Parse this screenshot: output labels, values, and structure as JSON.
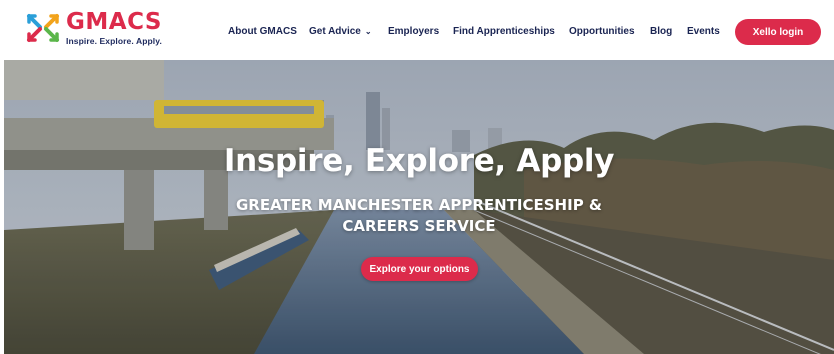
{
  "brand": {
    "name": "GMACS",
    "tagline": "Inspire. Explore. Apply.",
    "color": "#dc2b4b",
    "navy": "#1a2452"
  },
  "nav": {
    "items": [
      {
        "label": "About GMACS"
      },
      {
        "label": "Get Advice",
        "icon": "chevron-down-icon"
      },
      {
        "label": "Employers"
      },
      {
        "label": "Find Apprenticeships"
      },
      {
        "label": "Opportunities"
      },
      {
        "label": "Blog"
      },
      {
        "label": "Events"
      }
    ],
    "login_label": "Xello login"
  },
  "hero": {
    "title": "Inspire, Explore, Apply",
    "subtitle_line1": "GREATER MANCHESTER APPRENTICESHIP &",
    "subtitle_line2": "CAREERS SERVICE",
    "cta_label": "Explore your options"
  }
}
